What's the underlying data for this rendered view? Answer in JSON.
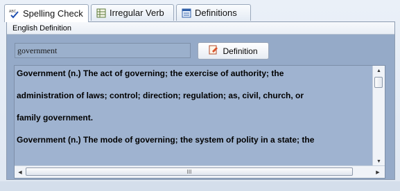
{
  "tabs": [
    {
      "label": "Spelling Check",
      "icon": "spell-check-icon",
      "active": true
    },
    {
      "label": "Irregular Verb",
      "icon": "table-icon",
      "active": false
    },
    {
      "label": "Definitions",
      "icon": "window-icon",
      "active": false
    }
  ],
  "panel": {
    "header": "English Definition"
  },
  "search": {
    "value": "government"
  },
  "definition_button": {
    "label": "Definition",
    "icon": "note-edit-icon"
  },
  "definition": {
    "lines": [
      "Government (n.) The act of governing; the exercise of authority; the",
      "administration of laws; control; direction; regulation; as, civil, church, or",
      "family government.",
      "Government (n.) The mode of governing; the system of polity in a state; the"
    ]
  },
  "scrollbar": {
    "grip": "III"
  },
  "colors": {
    "content_bg": "#95aac8",
    "definition_bg": "#9fb3d0",
    "tab_active": "#ffffff"
  }
}
